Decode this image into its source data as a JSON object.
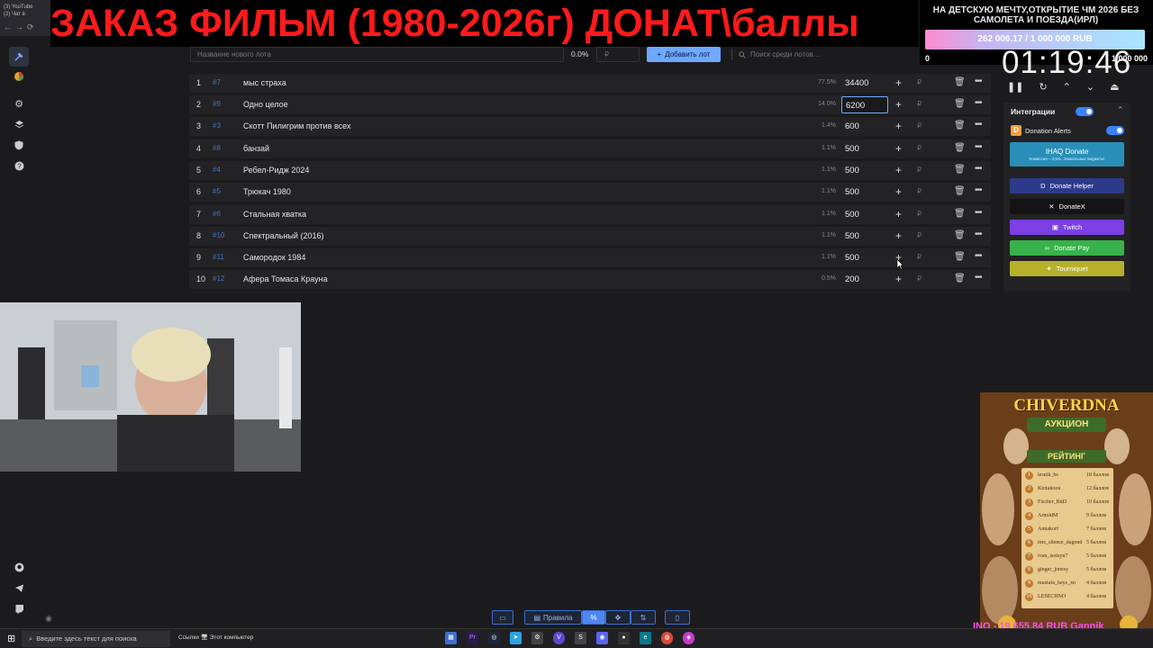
{
  "browser": {
    "tabs": [
      "(3) YouTube",
      "(2) Чат в"
    ],
    "nav_glyphs": [
      "←",
      "→",
      "⟳"
    ]
  },
  "overlay_title": "ЗАКАЗ ФИЛЬМ (1980-2026г) ДОНАТ\\баллы",
  "goal": {
    "title": "НА ДЕТСКУЮ МЕЧТУ,ОТКРЫТИЕ ЧМ 2026 БЕЗ САМОЛЕТА И ПОЕЗДА(ИРЛ)",
    "progress_text": "262 006.17 / 1 000 000 RUB",
    "progress": 0.262,
    "min": "0",
    "max": "1 000 000"
  },
  "toolbar": {
    "new_lot_placeholder": "Название нового лота",
    "pct": "0.0%",
    "amount_placeholder": "₽",
    "add_lot_label": "Добавить лот",
    "search_placeholder": "Поиск среди лотов..."
  },
  "lots": [
    {
      "num": "1",
      "id": "#7",
      "name": "мыс страха",
      "pct": "77.5%",
      "amount": "34400"
    },
    {
      "num": "2",
      "id": "#9",
      "name": "Одно целое",
      "pct": "14.0%",
      "amount": "6200"
    },
    {
      "num": "3",
      "id": "#3",
      "name": "Скотт Пилигрим против всех",
      "pct": "1.4%",
      "amount": "600"
    },
    {
      "num": "4",
      "id": "#8",
      "name": "банзай",
      "pct": "1.1%",
      "amount": "500"
    },
    {
      "num": "5",
      "id": "#4",
      "name": "Ребел-Ридж 2024",
      "pct": "1.1%",
      "amount": "500"
    },
    {
      "num": "6",
      "id": "#5",
      "name": "Трюкач 1980",
      "pct": "1.1%",
      "amount": "500"
    },
    {
      "num": "7",
      "id": "#6",
      "name": "Стальная хватка",
      "pct": "1.1%",
      "amount": "500"
    },
    {
      "num": "8",
      "id": "#10",
      "name": "Спектральный (2016)",
      "pct": "1.1%",
      "amount": "500"
    },
    {
      "num": "9",
      "id": "#11",
      "name": "Самородок 1984",
      "pct": "1.1%",
      "amount": "500"
    },
    {
      "num": "10",
      "id": "#12",
      "name": "Афера Томаса Крауна",
      "pct": "0.5%",
      "amount": "200"
    }
  ],
  "lot_currency": "₽",
  "timer": "01:19:46",
  "integrations": {
    "title": "Интеграции",
    "donation_alerts": "Donation Alerts",
    "buttons": [
      {
        "label": "IHAQ Donate",
        "sub": "Комиссия – 3,5%. Уникальные виджеты!",
        "color": "#2a8fb8"
      },
      {
        "label": "Donate Helper",
        "color": "#2c3a8a"
      },
      {
        "label": "DonateX",
        "color": "#141416"
      },
      {
        "label": "Twitch",
        "color": "#7b3fe4"
      },
      {
        "label": "Donate Pay",
        "color": "#38b24a"
      },
      {
        "label": "Tourniquet",
        "color": "#b6b02b"
      }
    ]
  },
  "auction": {
    "title": "CHIVERDNA",
    "subtitle": "АУКЦИОН",
    "rating": "РЕЙТИНГ",
    "leaders": [
      {
        "rank": "1",
        "name": "lesnik_bs",
        "score": "18 баллов"
      },
      {
        "rank": "2",
        "name": "Ktotakoou",
        "score": "12 баллов"
      },
      {
        "rank": "3",
        "name": "Fischer_RnD",
        "score": "10 баллов"
      },
      {
        "rank": "4",
        "name": "ArnoldM",
        "score": "9 баллов"
      },
      {
        "rank": "5",
        "name": "Annakorf",
        "score": "7 баллов"
      },
      {
        "rank": "6",
        "name": "mrs_silence_dagond",
        "score": "5 баллов"
      },
      {
        "rank": "7",
        "name": "ivan_isotsyn7",
        "score": "5 баллов"
      },
      {
        "rank": "8",
        "name": "ginger_jonesy",
        "score": "5 баллов"
      },
      {
        "rank": "9",
        "name": "mustafa_beys_xn",
        "score": "4 баллов"
      },
      {
        "rank": "10",
        "name": "LESECHNO",
        "score": "4 баллов"
      }
    ]
  },
  "ticker": "INO - 19 655,84 RUB     Gannik",
  "bottom_bar": {
    "rules_label": "Правила"
  },
  "taskbar": {
    "search_placeholder": "Введите здесь текст для поиска",
    "links": "Ссылки  🖥 Этот компьютер"
  },
  "colors": {
    "accent": "#6ea8ff",
    "lot_id": "#3f72c8",
    "title_red": "#ff1a1a"
  }
}
